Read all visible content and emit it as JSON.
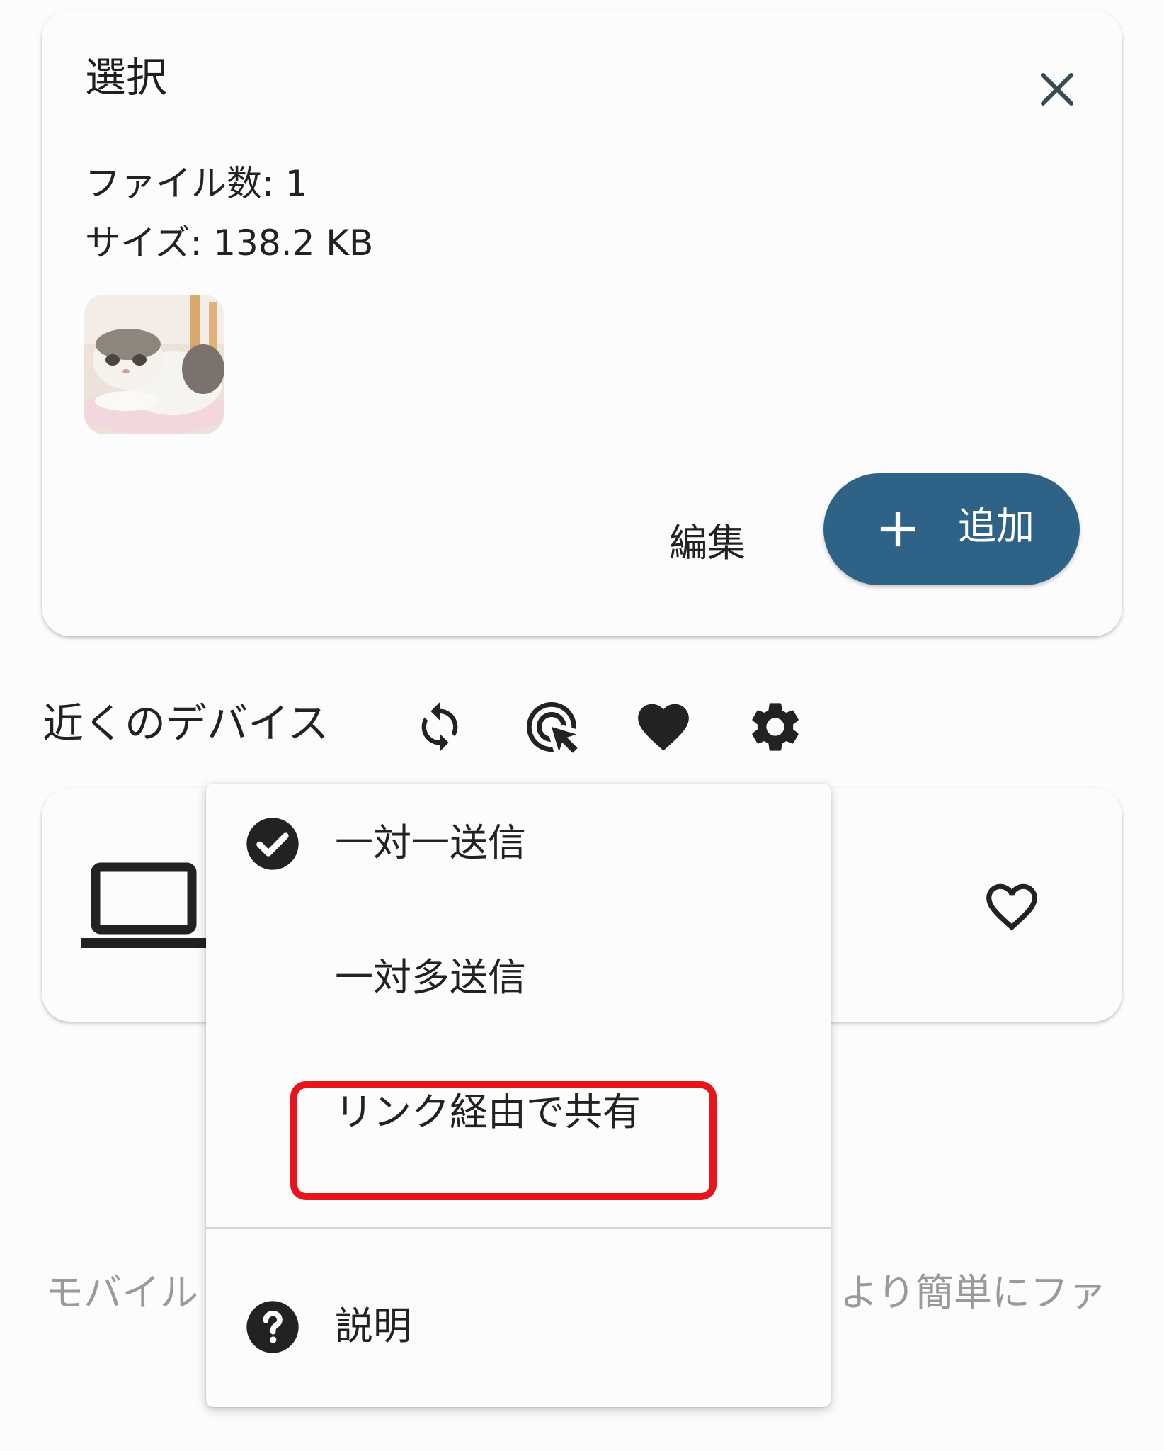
{
  "colors": {
    "accent": "#2f6287",
    "highlight": "#e8141b",
    "background": "#fcfcfd",
    "icon": "#222222",
    "muted_text": "#9a9a9a"
  },
  "selection": {
    "title": "選択",
    "close_icon": "close-icon",
    "file_count": "ファイル数: 1",
    "file_size": "サイズ: 138.2 KB",
    "thumbnail": "cat-photo-thumbnail",
    "edit_label": "編集",
    "add_label": "追加",
    "add_icon": "plus-icon"
  },
  "nearby": {
    "title": "近くのデバイス",
    "icons": [
      "refresh-icon",
      "scan-icon",
      "heart-icon",
      "gear-icon"
    ]
  },
  "device_card": {
    "device_icon": "laptop-icon",
    "favorite_icon": "heart-outline-icon"
  },
  "hint": {
    "left_fragment": "モバイル",
    "right_fragment": "より簡単にファ"
  },
  "menu": {
    "items": [
      {
        "label": "一対一送信",
        "icon": "check-circle-icon",
        "checked": true
      },
      {
        "label": "一対多送信",
        "checked": false
      },
      {
        "label": "リンク経由で共有",
        "checked": false,
        "highlighted": true
      }
    ],
    "help": {
      "label": "説明",
      "icon": "help-circle-icon"
    }
  }
}
